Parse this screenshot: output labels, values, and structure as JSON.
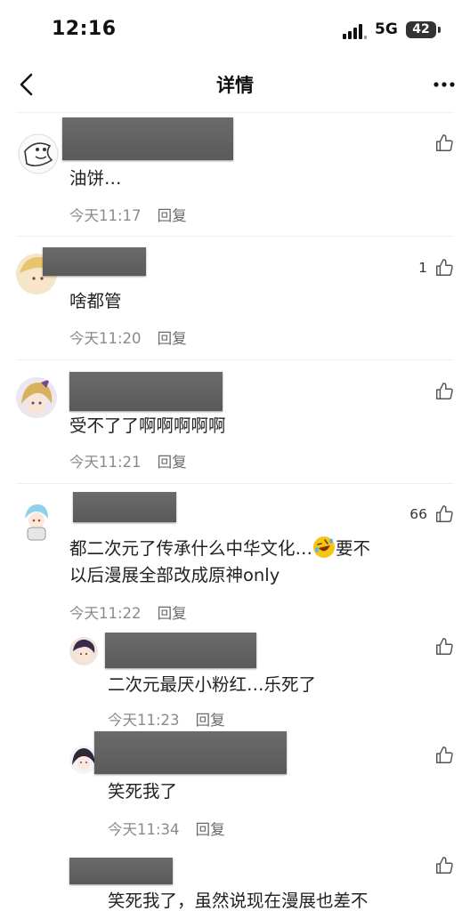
{
  "status": {
    "time": "12:16",
    "network": "5G",
    "battery": "42"
  },
  "nav": {
    "title": "详情"
  },
  "comments": [
    {
      "text": "油饼…",
      "time": "今天11:17",
      "reply": "回复",
      "likes": ""
    },
    {
      "text": "啥都管",
      "time": "今天11:20",
      "reply": "回复",
      "likes": "1"
    },
    {
      "text": "受不了了啊啊啊啊啊",
      "time": "今天11:21",
      "reply": "回复",
      "likes": ""
    },
    {
      "text_a": "都二次元了传承什么中华文化…",
      "text_b": "要不",
      "text_line2": "以后漫展全部改成原神only",
      "time": "今天11:22",
      "reply": "回复",
      "likes": "66",
      "emoji": "rofl-emoji"
    }
  ],
  "replies": [
    {
      "text": "二次元最厌小粉红…乐死了",
      "time": "今天11:23",
      "reply": "回复",
      "likes": ""
    },
    {
      "text": "笑死我了",
      "time": "今天11:34",
      "reply": "回复",
      "likes": ""
    },
    {
      "text": "笑死我了，虽然说现在漫展也差不",
      "likes": ""
    }
  ],
  "icons": {
    "back": "chevron-left-icon",
    "more": "more-dots-icon",
    "like": "thumbs-up-icon"
  }
}
